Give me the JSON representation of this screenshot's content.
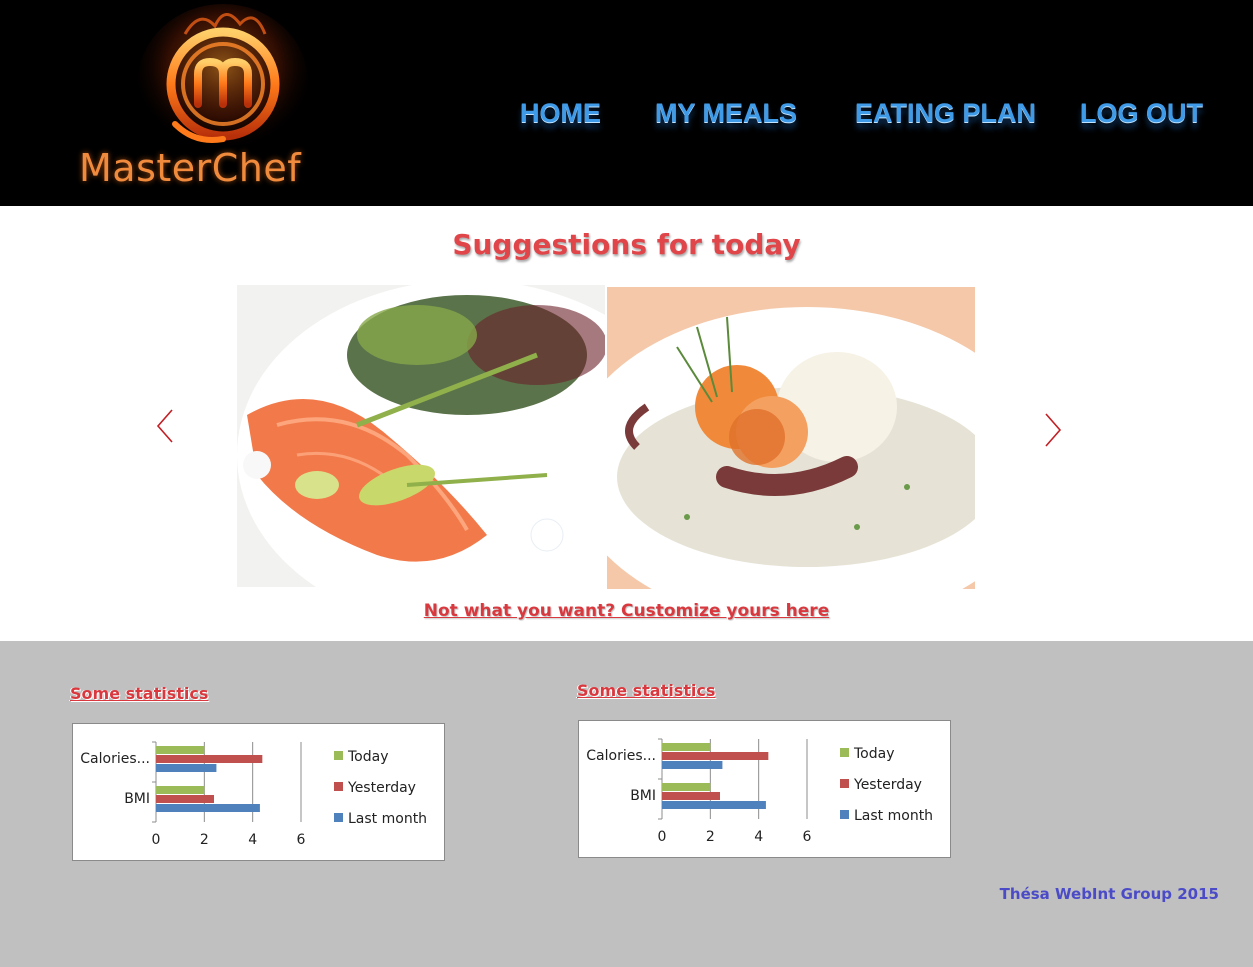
{
  "header": {
    "logo_text": "MasterChef",
    "nav": [
      {
        "label": "HOME"
      },
      {
        "label": "MY MEALS"
      },
      {
        "label": "EATING PLAN"
      },
      {
        "label": "LOG OUT"
      }
    ]
  },
  "suggestions": {
    "title": "Suggestions for today",
    "customize_link": "Not what you want? Customize yours here"
  },
  "stats": [
    {
      "title": "Some statistics"
    },
    {
      "title": "Some statistics"
    }
  ],
  "colors": {
    "today": "#9bbb59",
    "yesterday": "#c0504d",
    "last_month": "#4f81bd",
    "title_red": "#e0454a",
    "nav_blue": "#3f9be8",
    "footer_blue": "#4b4bc8"
  },
  "chart_data": [
    {
      "type": "bar",
      "orientation": "horizontal",
      "categories": [
        "Calories...",
        "BMI"
      ],
      "series": [
        {
          "name": "Today",
          "values": [
            2.0,
            2.0
          ]
        },
        {
          "name": "Yesterday",
          "values": [
            4.4,
            2.4
          ]
        },
        {
          "name": "Last month",
          "values": [
            2.5,
            4.3
          ]
        }
      ],
      "xlim": [
        0,
        6
      ],
      "xticks": [
        "0",
        "2",
        "4",
        "6"
      ],
      "legend": "right",
      "grid": true
    },
    {
      "type": "bar",
      "orientation": "horizontal",
      "categories": [
        "Calories...",
        "BMI"
      ],
      "series": [
        {
          "name": "Today",
          "values": [
            2.0,
            2.0
          ]
        },
        {
          "name": "Yesterday",
          "values": [
            4.4,
            2.4
          ]
        },
        {
          "name": "Last month",
          "values": [
            2.5,
            4.3
          ]
        }
      ],
      "xlim": [
        0,
        6
      ],
      "xticks": [
        "0",
        "2",
        "4",
        "6"
      ],
      "legend": "right",
      "grid": true
    }
  ],
  "footer": {
    "text": "Thésa WebInt Group 2015"
  }
}
